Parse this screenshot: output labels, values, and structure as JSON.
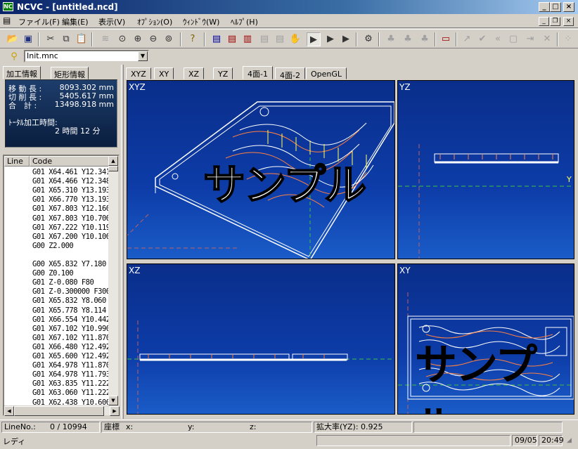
{
  "window": {
    "title": "NCVC - [untitled.ncd]",
    "app_icon": "NC"
  },
  "menu": [
    "ファイル(F)",
    "編集(E)",
    "表示(V)",
    "ｵﾌﾟｼｮﾝ(O)",
    "ｳｨﾝﾄﾞｳ(W)",
    "ﾍﾙﾌﾟ(H)"
  ],
  "toolbar2": {
    "combo_value": "Init.mnc"
  },
  "left_tabs": [
    "加工情報",
    "矩形情報"
  ],
  "info": {
    "move_label": "移 動 長 :",
    "move_value": "8093.302 mm",
    "cut_label": "切 削 長 :",
    "cut_value": "5405.617 mm",
    "total_label": "合　計 :",
    "total_value": "13498.918 mm",
    "time_label": "ﾄｰﾀﾙ加工時間:",
    "time_value": "2 時間 12 分"
  },
  "code_list": {
    "headers": [
      "Line",
      "Code"
    ],
    "rows": [
      "G01 X64.461 Y12.341",
      "G01 X64.466 Y12.348",
      "G01 X65.310 Y13.193",
      "G01 X66.770 Y13.193",
      "G01 X67.803 Y12.160",
      "G01 X67.803 Y10.700",
      "G01 X67.222 Y10.119",
      "G01 X67.200 Y10.100",
      "G00 Z2.000",
      "",
      "G00 X65.832 Y7.180",
      "G00 Z0.100",
      "G01 Z-0.080 F80",
      "G01 Z-0.300000 F300",
      "G01 X65.832 Y8.060 F",
      "G01 X65.778 Y8.114 F",
      "G01 X66.554 Y10.442",
      "G01 X67.102 Y10.990",
      "G01 X67.102 Y11.870",
      "G01 X66.480 Y12.492",
      "G01 X65.600 Y12.492",
      "G01 X64.978 Y11.870",
      "G01 X64.978 Y11.793",
      "G01 X63.835 Y11.222",
      "G01 X63.060 Y11.222",
      "G01 X62.438 Y10.600",
      "G01 X62.438 Y9.780"
    ]
  },
  "view_tabs": [
    "XYZ",
    "XY",
    "XZ",
    "YZ",
    "4面-1",
    "4面-2",
    "OpenGL"
  ],
  "panes": {
    "xyz": "XYZ",
    "yz": "YZ",
    "xz": "XZ",
    "xy": "XY",
    "axis_y": "Y"
  },
  "watermark": "サンプル",
  "status": {
    "line_label": "LineNo.:",
    "line_value": "0 / 10994",
    "coord_label": "座標",
    "x_label": "x:",
    "y_label": "y:",
    "z_label": "z:",
    "zoom": "拡大率(YZ): 0.925",
    "ready": "レディ",
    "date": "09/05",
    "time": "20:49"
  },
  "colors": {
    "title_start": "#0a246a",
    "pane_bg": "#0d3ca8"
  }
}
